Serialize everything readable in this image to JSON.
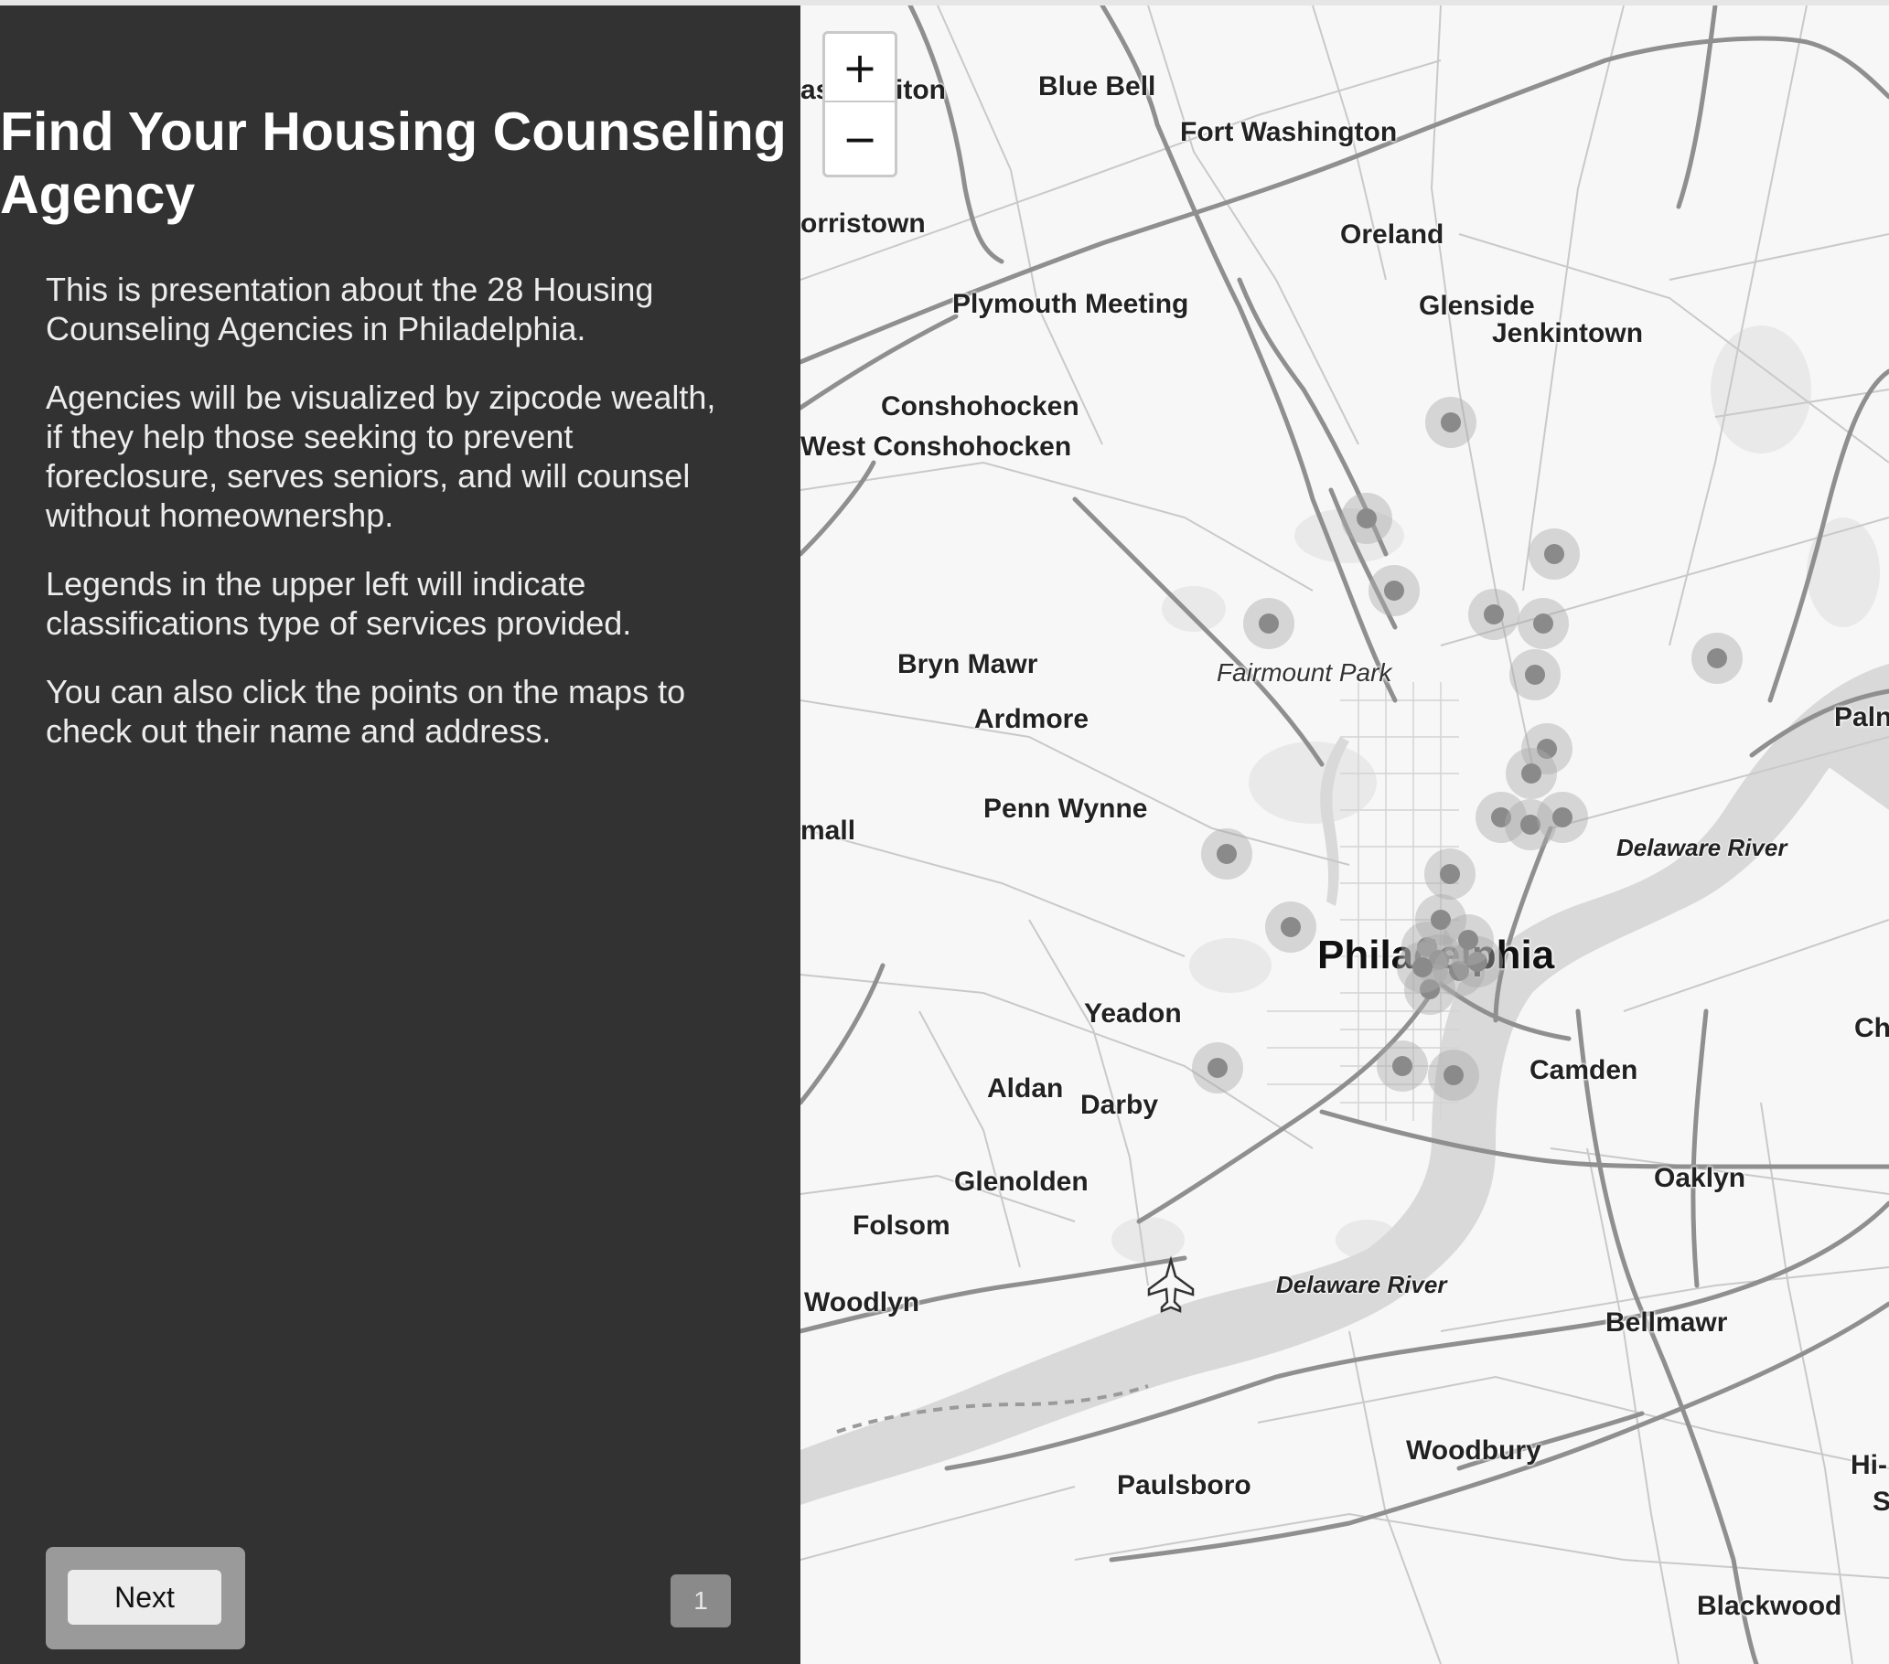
{
  "sidebar": {
    "title": "Find Your Housing Counseling Agency",
    "paragraphs": [
      "This is presentation about the 28 Housing Counseling Agencies in Philadelphia.",
      "Agencies will be visualized by zipcode wealth, if they help those seeking to prevent foreclosure, serves seniors, and will counsel without homeownershp.",
      "Legends in the upper left will indicate classifications type of services provided.",
      "You can also click the points on the maps to check out their name and address."
    ],
    "next_label": "Next",
    "page_number": "1"
  },
  "map": {
    "zoom_in": "+",
    "zoom_out": "−",
    "places": {
      "blue_bell": "Blue Bell",
      "iton": "iton",
      "ast": "ast",
      "fort_washington": "Fort Washington",
      "orristown": "orristown",
      "oreland": "Oreland",
      "plymouth_meeting": "Plymouth Meeting",
      "glenside": "Glenside",
      "jenkintown": "Jenkintown",
      "conshohocken": "Conshohocken",
      "west_conshohocken": "West Conshohocken",
      "bryn_mawr": "Bryn Mawr",
      "fairmount_park": "Fairmount Park",
      "ardmore": "Ardmore",
      "paln": "Paln",
      "mall": "mall",
      "penn_wynne": "Penn Wynne",
      "philadelphia": "Philadelphia",
      "yeadon": "Yeadon",
      "ch": "Ch",
      "camden": "Camden",
      "aldan": "Aldan",
      "darby": "Darby",
      "glenolden": "Glenolden",
      "oaklyn": "Oaklyn",
      "folsom": "Folsom",
      "woodlyn": "Woodlyn",
      "bellmawr": "Bellmawr",
      "woodbury": "Woodbury",
      "paulsboro": "Paulsboro",
      "hi": "Hi-",
      "s": "S",
      "blackwood": "Blackwood"
    },
    "water_labels": {
      "delaware_river_north": "Delaware River",
      "delaware_river_south": "Delaware River"
    },
    "agency_count": 28
  },
  "colors": {
    "sidebar_bg": "#323232",
    "map_bg": "#f7f7f7",
    "water": "#d9d9d9",
    "marker_dot": "#8a8a8a",
    "marker_halo": "#aaaaaa"
  }
}
